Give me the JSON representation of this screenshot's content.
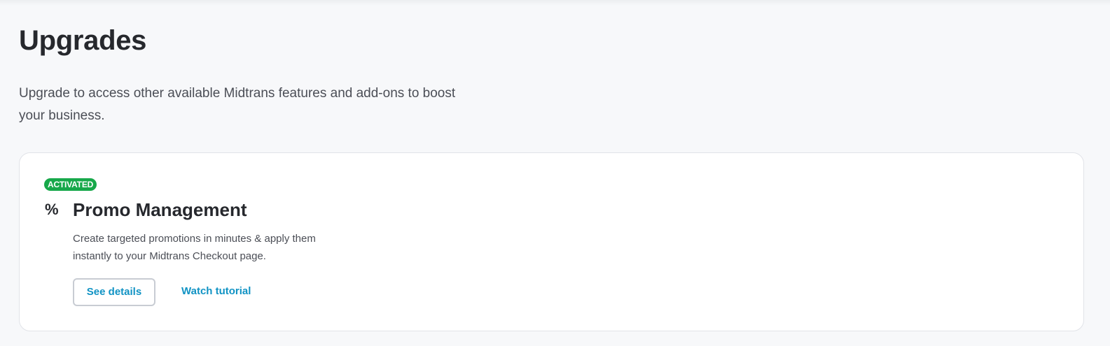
{
  "page": {
    "title": "Upgrades",
    "description": "Upgrade to access other available Midtrans features and add-ons to boost your business."
  },
  "features": [
    {
      "status_badge": "ACTIVATED",
      "icon": "percent-icon",
      "icon_glyph": "%",
      "title": "Promo Management",
      "description": "Create targeted promotions in minutes & apply them instantly to your Midtrans Checkout page.",
      "primary_action": "See details",
      "secondary_action": "Watch tutorial"
    }
  ],
  "colors": {
    "background": "#f7f8fa",
    "card": "#ffffff",
    "badge_green": "#17a84a",
    "link_blue": "#1193c4",
    "text_dark": "#26282d",
    "text_muted": "#4b4e56"
  }
}
